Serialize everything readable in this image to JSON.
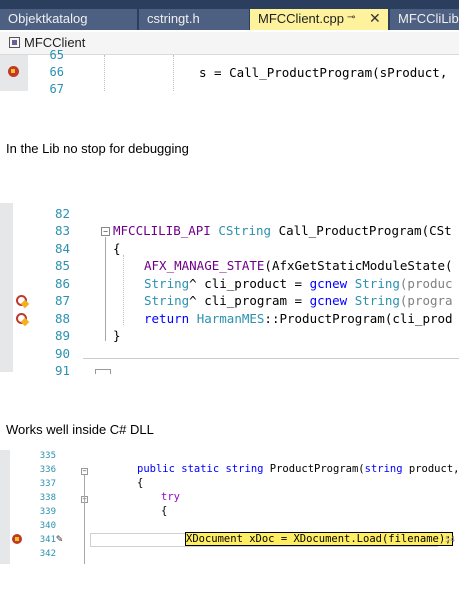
{
  "tabs": [
    {
      "label": "Objektkatalog"
    },
    {
      "label": "cstringt.h"
    },
    {
      "label": "MFCClient.cpp",
      "pin": "⊸",
      "close": "✕"
    },
    {
      "label": "MFCCliLib."
    }
  ],
  "navbar": {
    "scope": "MFCClient"
  },
  "editor1": {
    "lines": [
      {
        "num": "65",
        "code": ""
      },
      {
        "num": "66",
        "code": "s = Call_ProductProgram(sProduct, "
      },
      {
        "num": "67",
        "code": ""
      }
    ]
  },
  "caption1": "In the Lib no stop for debugging",
  "editor2": {
    "lines": [
      {
        "num": "82"
      },
      {
        "num": "83",
        "parts": [
          "MFCCLILIB_API",
          " CString ",
          "Call_ProductProgram(CSt"
        ]
      },
      {
        "num": "84",
        "code": "{"
      },
      {
        "num": "85",
        "parts": [
          "AFX_MANAGE_STATE",
          "(AfxGetStaticModuleState("
        ]
      },
      {
        "num": "86",
        "parts": [
          "String",
          "^ cli_product = ",
          "gcnew",
          " ",
          "String",
          "(produc"
        ]
      },
      {
        "num": "87",
        "parts": [
          "String",
          "^ cli_program = ",
          "gcnew",
          " ",
          "String",
          "(progra"
        ]
      },
      {
        "num": "88",
        "parts": [
          "return",
          " ",
          "HarmanMES",
          "::ProductProgram(cli_prod"
        ]
      },
      {
        "num": "89",
        "code": "}"
      },
      {
        "num": "90"
      },
      {
        "num": "91"
      }
    ]
  },
  "caption2": "Works well inside C# DLL",
  "editor3": {
    "lines": [
      {
        "num": "335"
      },
      {
        "num": "336",
        "parts": [
          "public",
          " ",
          "static",
          " ",
          "string",
          " ProductProgram(",
          "string",
          " product, st"
        ]
      },
      {
        "num": "337",
        "code": "{"
      },
      {
        "num": "338",
        "parts": [
          "try"
        ]
      },
      {
        "num": "339",
        "code": "{"
      },
      {
        "num": "340"
      },
      {
        "num": "341",
        "code": "XDocument xDoc = XDocument.Load(filename);",
        "suffix": "54"
      },
      {
        "num": "342"
      }
    ]
  },
  "colors": {
    "keyword": "#0000ff",
    "type": "#2b91af",
    "macro": "#6f008a",
    "tab_active": "#fff29d",
    "tab_bar": "#2b3e5e",
    "breakpoint": "#c0392b",
    "highlight": "#ffee62"
  }
}
